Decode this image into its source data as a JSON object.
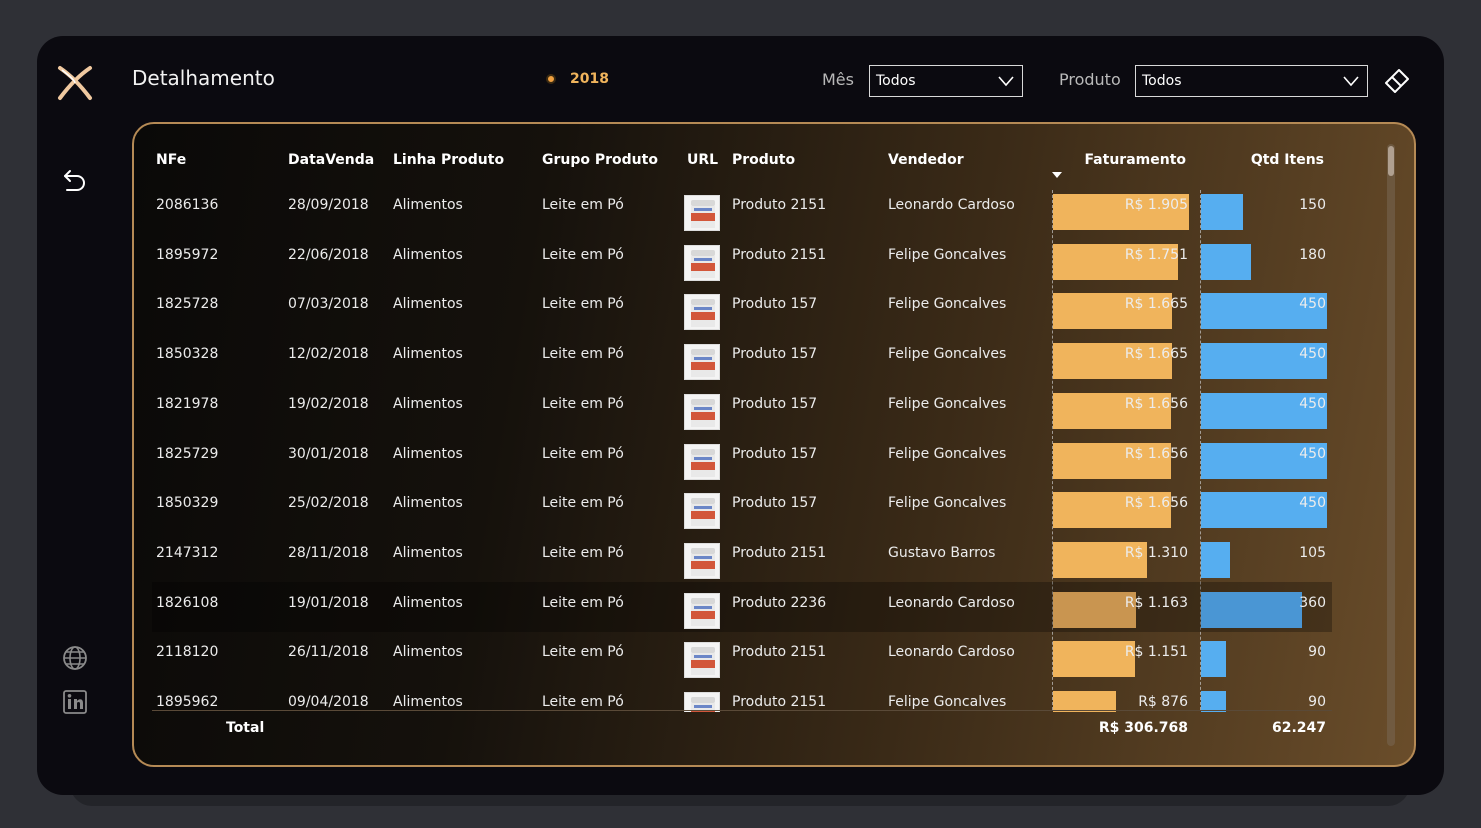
{
  "header": {
    "title": "Detalhamento",
    "year": "2018",
    "mes_label": "Mês",
    "mes_value": "Todos",
    "produto_label": "Produto",
    "produto_value": "Todos"
  },
  "colors": {
    "accent_orange": "#f0b45c",
    "accent_blue": "#56aef0",
    "panel_border": "#b58a55"
  },
  "nav": {
    "back_icon": "back-arrow-icon",
    "globe_icon": "globe-icon",
    "linkedin_icon": "linkedin-icon",
    "eraser_icon": "eraser-icon"
  },
  "table": {
    "columns": [
      "NFe",
      "DataVenda",
      "Linha Produto",
      "Grupo Produto",
      "URL",
      "Produto",
      "Vendedor",
      "Faturamento",
      "Qtd Itens"
    ],
    "max_faturamento": 1905,
    "max_qtd": 450,
    "rows": [
      {
        "nfe": "2086136",
        "data": "28/09/2018",
        "linha": "Alimentos",
        "grupo": "Leite em Pó",
        "produto": "Produto 2151",
        "vendedor": "Leonardo Cardoso",
        "fat_label": "R$ 1.905",
        "fat": 1905,
        "qtd_label": "150",
        "qtd": 150
      },
      {
        "nfe": "1895972",
        "data": "22/06/2018",
        "linha": "Alimentos",
        "grupo": "Leite em Pó",
        "produto": "Produto 2151",
        "vendedor": "Felipe Goncalves",
        "fat_label": "R$ 1.751",
        "fat": 1751,
        "qtd_label": "180",
        "qtd": 180
      },
      {
        "nfe": "1825728",
        "data": "07/03/2018",
        "linha": "Alimentos",
        "grupo": "Leite em Pó",
        "produto": "Produto 157",
        "vendedor": "Felipe Goncalves",
        "fat_label": "R$ 1.665",
        "fat": 1665,
        "qtd_label": "450",
        "qtd": 450
      },
      {
        "nfe": "1850328",
        "data": "12/02/2018",
        "linha": "Alimentos",
        "grupo": "Leite em Pó",
        "produto": "Produto 157",
        "vendedor": "Felipe Goncalves",
        "fat_label": "R$ 1.665",
        "fat": 1665,
        "qtd_label": "450",
        "qtd": 450
      },
      {
        "nfe": "1821978",
        "data": "19/02/2018",
        "linha": "Alimentos",
        "grupo": "Leite em Pó",
        "produto": "Produto 157",
        "vendedor": "Felipe Goncalves",
        "fat_label": "R$ 1.656",
        "fat": 1656,
        "qtd_label": "450",
        "qtd": 450
      },
      {
        "nfe": "1825729",
        "data": "30/01/2018",
        "linha": "Alimentos",
        "grupo": "Leite em Pó",
        "produto": "Produto 157",
        "vendedor": "Felipe Goncalves",
        "fat_label": "R$ 1.656",
        "fat": 1656,
        "qtd_label": "450",
        "qtd": 450
      },
      {
        "nfe": "1850329",
        "data": "25/02/2018",
        "linha": "Alimentos",
        "grupo": "Leite em Pó",
        "produto": "Produto 157",
        "vendedor": "Felipe Goncalves",
        "fat_label": "R$ 1.656",
        "fat": 1656,
        "qtd_label": "450",
        "qtd": 450
      },
      {
        "nfe": "2147312",
        "data": "28/11/2018",
        "linha": "Alimentos",
        "grupo": "Leite em Pó",
        "produto": "Produto 2151",
        "vendedor": "Gustavo Barros",
        "fat_label": "R$ 1.310",
        "fat": 1310,
        "qtd_label": "105",
        "qtd": 105
      },
      {
        "nfe": "1826108",
        "data": "19/01/2018",
        "linha": "Alimentos",
        "grupo": "Leite em Pó",
        "produto": "Produto 2236",
        "vendedor": "Leonardo Cardoso",
        "fat_label": "R$ 1.163",
        "fat": 1163,
        "qtd_label": "360",
        "qtd": 360,
        "highlight": true
      },
      {
        "nfe": "2118120",
        "data": "26/11/2018",
        "linha": "Alimentos",
        "grupo": "Leite em Pó",
        "produto": "Produto 2151",
        "vendedor": "Leonardo Cardoso",
        "fat_label": "R$ 1.151",
        "fat": 1151,
        "qtd_label": "90",
        "qtd": 90
      },
      {
        "nfe": "1895962",
        "data": "09/04/2018",
        "linha": "Alimentos",
        "grupo": "Leite em Pó",
        "produto": "Produto 2151",
        "vendedor": "Felipe Goncalves",
        "fat_label": "R$ 876",
        "fat": 876,
        "qtd_label": "90",
        "qtd": 90
      }
    ],
    "total": {
      "label": "Total",
      "faturamento": "R$ 306.768",
      "qtd": "62.247"
    }
  }
}
